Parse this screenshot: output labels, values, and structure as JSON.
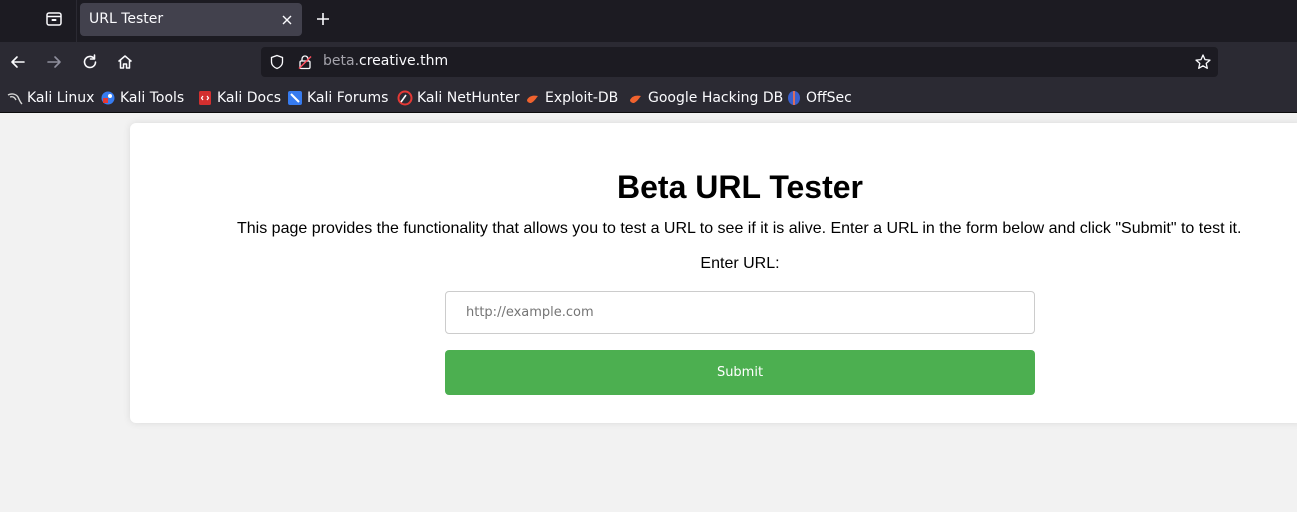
{
  "browser": {
    "tab": {
      "title": "URL Tester"
    },
    "address_bar": {
      "host_prefix": "beta.",
      "host_domain": "creative.thm"
    },
    "bookmarks": [
      {
        "label": "Kali Linux",
        "icon": "kali-dragon-icon"
      },
      {
        "label": "Kali Tools",
        "icon": "kali-tools-icon"
      },
      {
        "label": "Kali Docs",
        "icon": "kali-docs-icon"
      },
      {
        "label": "Kali Forums",
        "icon": "kali-forums-icon"
      },
      {
        "label": "Kali NetHunter",
        "icon": "kali-nethunter-icon"
      },
      {
        "label": "Exploit-DB",
        "icon": "exploit-db-icon"
      },
      {
        "label": "Google Hacking DB",
        "icon": "ghdb-icon"
      },
      {
        "label": "OffSec",
        "icon": "offsec-icon"
      }
    ]
  },
  "page": {
    "title": "Beta URL Tester",
    "description": "This page provides the functionality that allows you to test a URL to see if it is alive. Enter a URL in the form below and click \"Submit\" to test it.",
    "form": {
      "label": "Enter URL:",
      "input_value": "",
      "input_placeholder": "http://example.com",
      "submit_label": "Submit"
    }
  },
  "colors": {
    "submit_button": "#4caf50",
    "tab_bar": "#1c1b22",
    "toolbar": "#2b2a33",
    "page_background": "#f2f2f2"
  }
}
